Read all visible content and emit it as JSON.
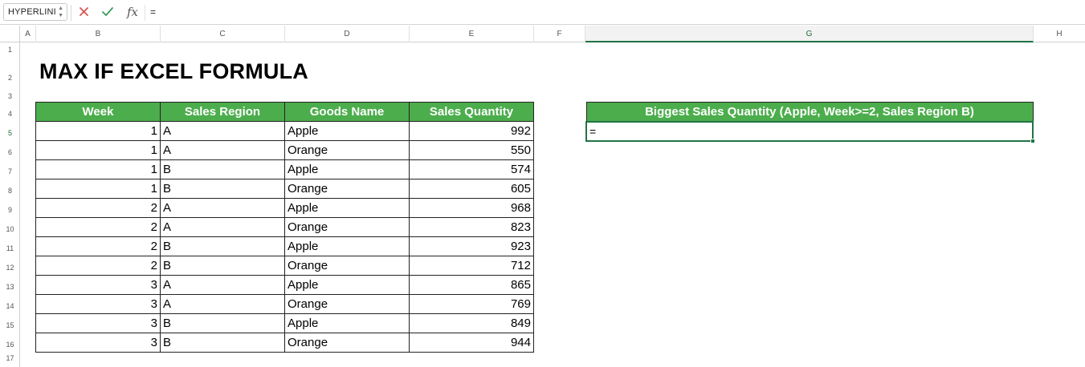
{
  "formula_bar": {
    "name_box": "HYPERLINI",
    "formula": "="
  },
  "columns": [
    "A",
    "B",
    "C",
    "D",
    "E",
    "F",
    "G",
    "H"
  ],
  "rows": [
    "1",
    "2",
    "3",
    "4",
    "5",
    "6",
    "7",
    "8",
    "9",
    "10",
    "11",
    "12",
    "13",
    "14",
    "15",
    "16",
    "17"
  ],
  "title": "MAX IF EXCEL FORMULA",
  "table": {
    "headers": [
      "Week",
      "Sales Region",
      "Goods Name",
      "Sales Quantity"
    ],
    "rows": [
      [
        "1",
        "A",
        "Apple",
        "992"
      ],
      [
        "1",
        "A",
        "Orange",
        "550"
      ],
      [
        "1",
        "B",
        "Apple",
        "574"
      ],
      [
        "1",
        "B",
        "Orange",
        "605"
      ],
      [
        "2",
        "A",
        "Apple",
        "968"
      ],
      [
        "2",
        "A",
        "Orange",
        "823"
      ],
      [
        "2",
        "B",
        "Apple",
        "923"
      ],
      [
        "2",
        "B",
        "Orange",
        "712"
      ],
      [
        "3",
        "A",
        "Apple",
        "865"
      ],
      [
        "3",
        "A",
        "Orange",
        "769"
      ],
      [
        "3",
        "B",
        "Apple",
        "849"
      ],
      [
        "3",
        "B",
        "Orange",
        "944"
      ]
    ]
  },
  "result": {
    "header": "Biggest Sales Quantity (Apple, Week>=2, Sales Region B)",
    "value": "="
  },
  "colors": {
    "header_green": "#4cad4c",
    "selection_green": "#217346",
    "cancel_red": "#d9534f",
    "enter_green": "#3a9d5d"
  },
  "icons": {
    "cancel": "x-icon",
    "enter": "check-icon",
    "function": "fx-icon"
  }
}
